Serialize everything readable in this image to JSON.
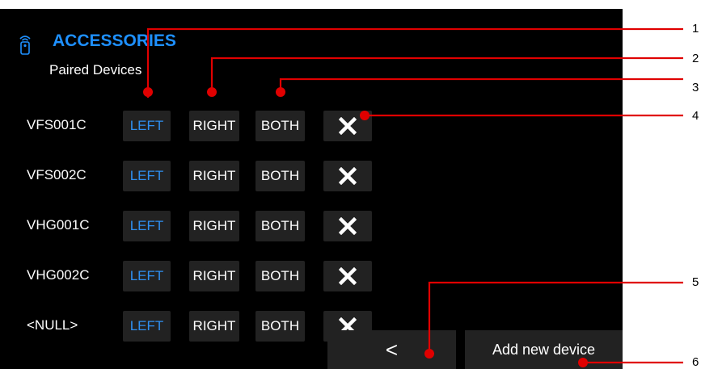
{
  "header": {
    "title": "ACCESSORIES",
    "subtitle": "Paired Devices",
    "icon": "remote-icon",
    "title_color": "#1e90ff"
  },
  "devices": [
    {
      "name": "VFS001C",
      "left": "LEFT",
      "right": "RIGHT",
      "both": "BOTH"
    },
    {
      "name": "VFS002C",
      "left": "LEFT",
      "right": "RIGHT",
      "both": "BOTH"
    },
    {
      "name": "VHG001C",
      "left": "LEFT",
      "right": "RIGHT",
      "both": "BOTH"
    },
    {
      "name": "VHG002C",
      "left": "LEFT",
      "right": "RIGHT",
      "both": "BOTH"
    },
    {
      "name": "<NULL>",
      "left": "LEFT",
      "right": "RIGHT",
      "both": "BOTH"
    }
  ],
  "footer": {
    "back_label": "<",
    "add_label": "Add new device"
  },
  "callouts": [
    "1",
    "2",
    "3",
    "4",
    "5",
    "6"
  ],
  "colors": {
    "screen_bg": "#000000",
    "button_bg": "#222222",
    "selected_text": "#2f8ff0",
    "callout": "#e00000"
  }
}
